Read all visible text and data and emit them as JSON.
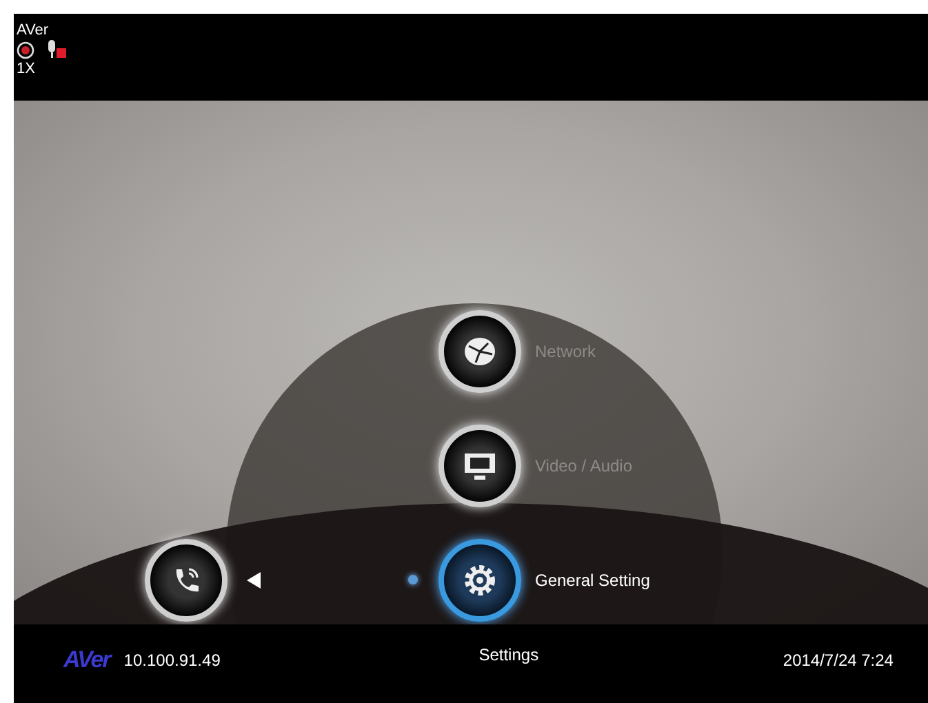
{
  "top_bar": {
    "title": "AVer",
    "zoom": "1X",
    "mic_muted": true
  },
  "menu": {
    "items": [
      {
        "label": "Network",
        "kind": "network",
        "selected": false
      },
      {
        "label": "Video / Audio",
        "kind": "video",
        "selected": false
      },
      {
        "label": "General Setting",
        "kind": "gear",
        "selected": true
      }
    ]
  },
  "side_menu": {
    "kind": "call",
    "selected": false
  },
  "status_bar": {
    "logo": "AVer",
    "ip": "10.100.91.49",
    "page": "Settings",
    "datetime": "2014/7/24 7:24"
  }
}
